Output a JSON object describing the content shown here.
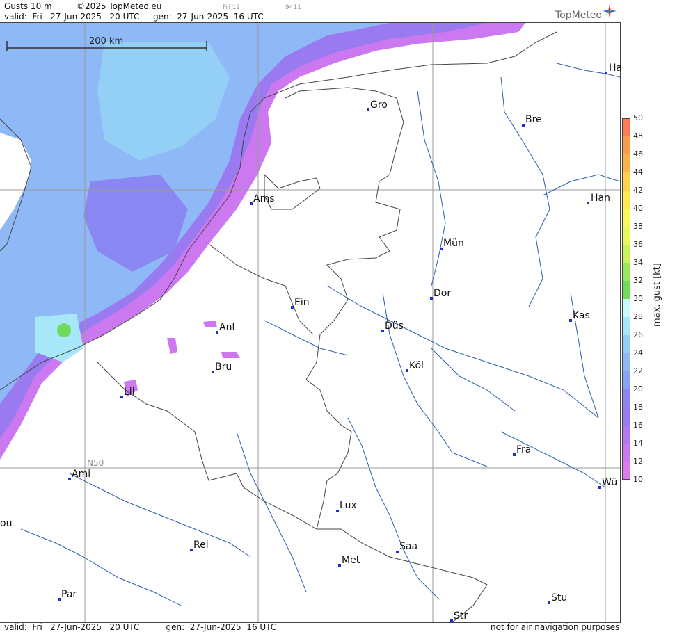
{
  "header": {
    "product": "Gusts 10 m",
    "copyright": "©2025 TopMeteo.eu",
    "run_small": "Fri 12",
    "code_small": "9411",
    "valid": "valid:  Fri   27-Jun-2025   20 UTC",
    "generated": "gen:  27-Jun-2025  16 UTC",
    "brand": "TopMeteo"
  },
  "footer": {
    "valid": "valid:  Fri   27-Jun-2025   20 UTC",
    "generated": "gen:  27-Jun-2025  16 UTC",
    "disclaimer": "not for air navigation purposes"
  },
  "map": {
    "scale_label": "200 km",
    "latitude_label": "N50",
    "cities": [
      {
        "label": "Ha"
      },
      {
        "label": "Gro"
      },
      {
        "label": "Bre"
      },
      {
        "label": "Ams"
      },
      {
        "label": "Han"
      },
      {
        "label": "Mün"
      },
      {
        "label": "Dor"
      },
      {
        "label": "Ein"
      },
      {
        "label": "Kas"
      },
      {
        "label": "Ant"
      },
      {
        "label": "Düs"
      },
      {
        "label": "Bru"
      },
      {
        "label": "Köl"
      },
      {
        "label": "Lil"
      },
      {
        "label": "Fra"
      },
      {
        "label": "Ami"
      },
      {
        "label": "Wü"
      },
      {
        "label": "ou"
      },
      {
        "label": "Lux"
      },
      {
        "label": "Rei"
      },
      {
        "label": "Saa"
      },
      {
        "label": "Met"
      },
      {
        "label": "Par"
      },
      {
        "label": "Stu"
      },
      {
        "label": "Str"
      }
    ]
  },
  "legend": {
    "title": "max. gust [kt]",
    "levels": [
      "50",
      "48",
      "46",
      "44",
      "42",
      "40",
      "38",
      "36",
      "34",
      "32",
      "30",
      "28",
      "26",
      "24",
      "22",
      "20",
      "18",
      "16",
      "14",
      "12",
      "10"
    ],
    "colors": [
      "#ff7a50",
      "#ff9a4c",
      "#ffb24a",
      "#ffd04a",
      "#ffe94c",
      "#f8f85a",
      "#e6f85a",
      "#c8f25a",
      "#98e85a",
      "#6cdc5a",
      "#c8fafa",
      "#a6e8f8",
      "#94cff5",
      "#8eb8f6",
      "#8aa2f5",
      "#8a87f2",
      "#9a7af0",
      "#b27af0",
      "#cc78f0",
      "#e278f2"
    ],
    "accent_border": "#444444"
  },
  "colors": {
    "city_dot": "#1b2fd6",
    "river": "#2a5db0",
    "border": "#444444",
    "grid": "#9a9a9a"
  }
}
